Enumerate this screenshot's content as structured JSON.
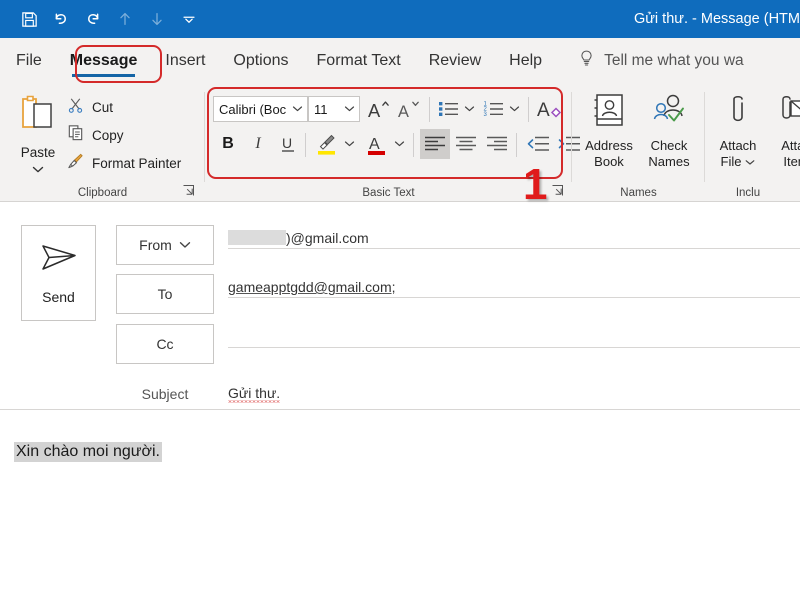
{
  "window": {
    "title": "Gửi thư.  -  Message (HTM",
    "accent_color": "#0f6cbd",
    "annotation_color": "#d42a2a"
  },
  "quick_access": [
    {
      "name": "save-icon",
      "label": "Save",
      "enabled": true
    },
    {
      "name": "undo-icon",
      "label": "Undo",
      "enabled": true
    },
    {
      "name": "redo-icon",
      "label": "Redo",
      "enabled": true
    },
    {
      "name": "previous-item-icon",
      "label": "Previous Item",
      "enabled": false
    },
    {
      "name": "next-item-icon",
      "label": "Next Item",
      "enabled": false
    },
    {
      "name": "customize-quick-access-icon",
      "label": "Customize Quick Access Toolbar",
      "enabled": true
    }
  ],
  "tabs": [
    {
      "label": "File",
      "active": false
    },
    {
      "label": "Message",
      "active": true
    },
    {
      "label": "Insert",
      "active": false
    },
    {
      "label": "Options",
      "active": false
    },
    {
      "label": "Format Text",
      "active": false
    },
    {
      "label": "Review",
      "active": false
    },
    {
      "label": "Help",
      "active": false
    }
  ],
  "tell_me": {
    "label": "Tell me what you wa",
    "icon": "lightbulb-icon"
  },
  "ribbon": {
    "groups": [
      {
        "label": "Clipboard",
        "has_launcher": true
      },
      {
        "label": "Basic Text",
        "has_launcher": true
      },
      {
        "label": "Names",
        "has_launcher": false
      },
      {
        "label": "Inclu",
        "has_launcher": false
      }
    ],
    "clipboard": {
      "paste": "Paste",
      "cut": "Cut",
      "copy": "Copy",
      "format_painter": "Format Painter"
    },
    "basic_text": {
      "font_name": "Calibri (Boc",
      "font_size": "11",
      "buttons": [
        "grow-font",
        "shrink-font",
        "bullets",
        "numbering",
        "clear-formatting",
        "bold",
        "italic",
        "underline",
        "text-highlight",
        "font-color",
        "align-left",
        "align-center",
        "align-right",
        "decrease-indent",
        "increase-indent"
      ],
      "active_button": "align-left",
      "highlight_color": "#ffe600",
      "font_color": "#d40000"
    },
    "names": {
      "address_book": "Address\nBook",
      "address_book_line1": "Address",
      "address_book_line2": "Book",
      "check_names_line1": "Check",
      "check_names_line2": "Names"
    },
    "include": {
      "attach_file_line1": "Attach",
      "attach_file_line2": "File",
      "attach_item_line1": "Attac",
      "attach_item_line2": "Item"
    }
  },
  "annotation": {
    "step_number": "1"
  },
  "compose": {
    "send_label": "Send",
    "from_label": "From",
    "to_label": "To",
    "cc_label": "Cc",
    "subject_label": "Subject",
    "from_value_suffix": ")@gmail.com",
    "from_redacted": true,
    "to_value": "gameapptgdd@gmail.com;",
    "cc_value": "",
    "subject_value": "Gửi thư."
  },
  "body": {
    "text": "Xin chào moi người.",
    "selected": true,
    "selection_color": "#d3d3d3"
  }
}
